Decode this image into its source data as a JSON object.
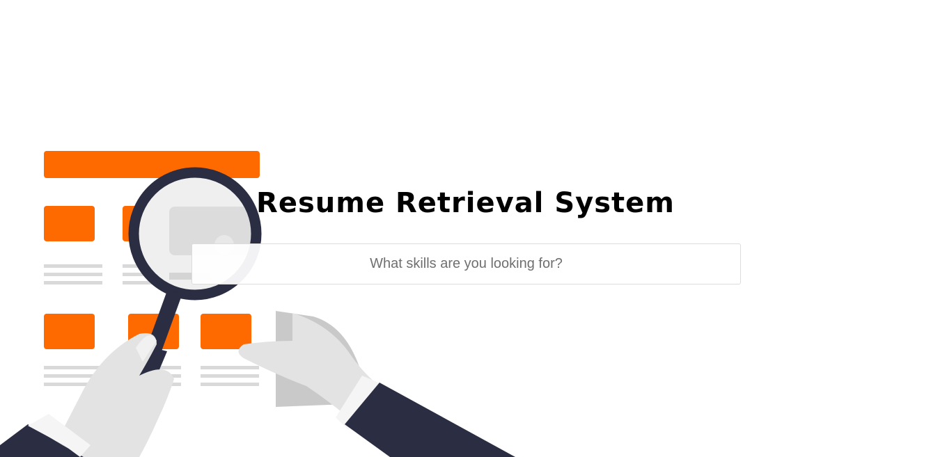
{
  "header": {
    "title": "Resume Retrieval System"
  },
  "search": {
    "placeholder": "What skills are you looking for?",
    "value": ""
  },
  "illustration": {
    "icon": "resume-search-illustration",
    "colors": {
      "accent": "#ff6a00",
      "navy": "#2b2d42",
      "light_gray": "#e2e2e2",
      "line_gray": "#d9d9d9"
    }
  }
}
